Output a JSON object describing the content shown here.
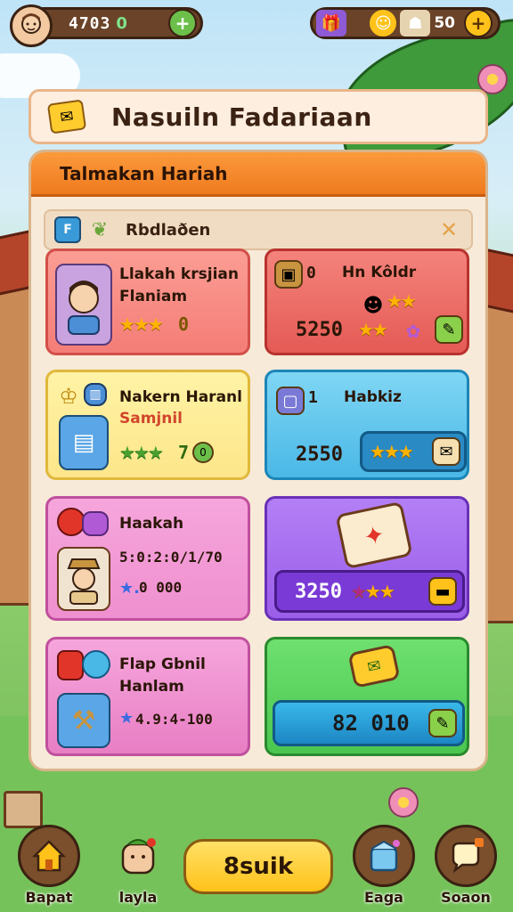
{
  "header": {
    "coins": "4703",
    "coins_sub": "0",
    "gems": "50"
  },
  "title": "Nasuiln Fadariaan",
  "panel": {
    "heading": "Talmakan Hariah",
    "subheading": "Rbdlaðen"
  },
  "cards": [
    {
      "id": "card-1",
      "name": "Llakah krsjian",
      "sub": "Flaniam",
      "value": "0"
    },
    {
      "id": "card-2",
      "badge": "0",
      "name": "Hn Kôldr",
      "price": "5250"
    },
    {
      "id": "card-3",
      "name": "Nakern Haranl",
      "sub": "Samjnil",
      "value": "7"
    },
    {
      "id": "card-4",
      "badge": "1",
      "name": "Habkiz",
      "price": "2550"
    },
    {
      "id": "card-5",
      "name": "Haakah",
      "line1": "5:0:2:0/1/70",
      "line2": "0 000"
    },
    {
      "id": "card-6",
      "price": "3250"
    },
    {
      "id": "card-7",
      "name": "Flap Gbnil",
      "sub": "Hanlam",
      "line1": "4.9:4-100"
    },
    {
      "id": "card-8",
      "price": "82 010"
    }
  ],
  "nav": {
    "item1": "Bapat",
    "item2": "layla",
    "center": "8suik",
    "item4": "Eaga",
    "item5": "Soaon"
  },
  "colors": {
    "orange_header": "#ef7a1f",
    "card_red": "#f47d77",
    "card_yellow": "#fde68a",
    "card_blue": "#5ec6ec",
    "card_pink": "#ef8fcf",
    "card_purple": "#a66bf0",
    "card_green": "#5ad15e",
    "button_yellow": "#ffc21a"
  }
}
